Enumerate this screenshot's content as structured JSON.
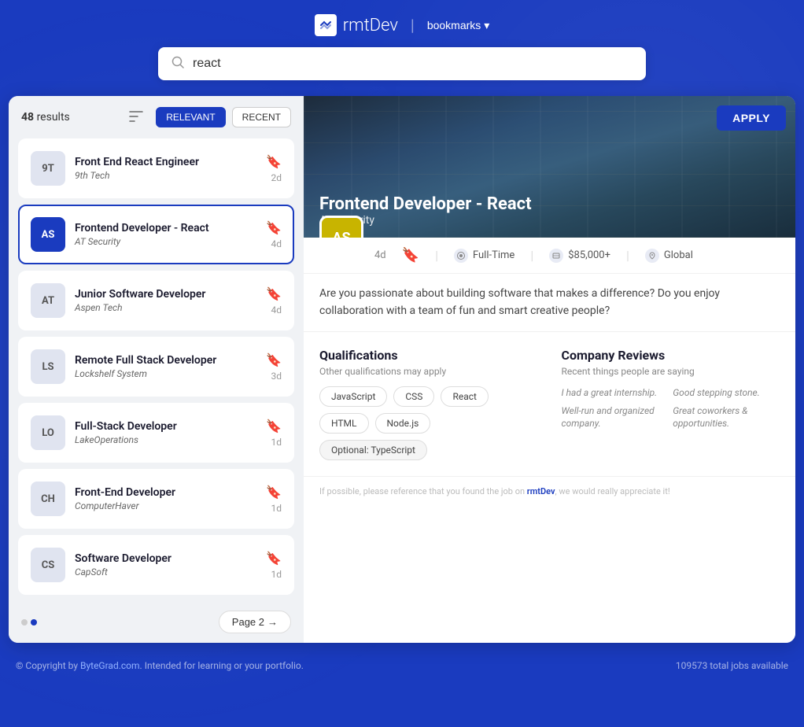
{
  "header": {
    "logo_text_rmt": "rmt",
    "logo_text_dev": "Dev",
    "bookmarks_label": "bookmarks",
    "search_value": "react"
  },
  "results": {
    "count": "48",
    "count_label": "results",
    "sort_relevant": "RELEVANT",
    "sort_recent": "RECENT"
  },
  "jobs": [
    {
      "id": "9t",
      "initials": "9T",
      "title": "Front End React Engineer",
      "company": "9th Tech",
      "age": "2d",
      "selected": false
    },
    {
      "id": "as",
      "initials": "AS",
      "title": "Frontend Developer - React",
      "company": "AT Security",
      "age": "4d",
      "selected": true
    },
    {
      "id": "at",
      "initials": "AT",
      "title": "Junior Software Developer",
      "company": "Aspen Tech",
      "age": "4d",
      "selected": false
    },
    {
      "id": "ls",
      "initials": "LS",
      "title": "Remote Full Stack Developer",
      "company": "Lockshelf System",
      "age": "3d",
      "selected": false
    },
    {
      "id": "lo",
      "initials": "LO",
      "title": "Full-Stack Developer",
      "company": "LakeOperations",
      "age": "1d",
      "selected": false
    },
    {
      "id": "ch",
      "initials": "CH",
      "title": "Front-End Developer",
      "company": "ComputerHaver",
      "age": "1d",
      "selected": false
    },
    {
      "id": "cs",
      "initials": "CS",
      "title": "Software Developer",
      "company": "CapSoft",
      "age": "1d",
      "selected": false
    }
  ],
  "pagination": {
    "current_page": "Page 2",
    "next_arrow": "→"
  },
  "detail": {
    "company_initials": "AS",
    "job_title": "Frontend Developer - React",
    "company_name": "AT Security",
    "description": "Are you passionate about building software that makes a difference? Do you enjoy collaboration with a team of fun and smart creative people?",
    "age": "4d",
    "employment_type": "Full-Time",
    "salary": "$85,000+",
    "location": "Global",
    "apply_label": "APPLY",
    "qualifications": {
      "title": "Qualifications",
      "subtitle": "Other qualifications may apply",
      "tags": [
        "JavaScript",
        "CSS",
        "React",
        "HTML",
        "Node.js"
      ],
      "optional_tag": "Optional: TypeScript"
    },
    "reviews": {
      "title": "Company Reviews",
      "subtitle": "Recent things people are saying",
      "items": [
        "I had a great internship.",
        "Good stepping stone.",
        "Well-run and organized company.",
        "Great coworkers & opportunities."
      ]
    },
    "footer_text": "If possible, please reference that you found the job on ",
    "footer_brand": "rmtDev",
    "footer_text2": ", we would really appreciate it!"
  },
  "site_footer": {
    "copyright": "© Copyright by ",
    "copyright_link": "ByteGrad.com",
    "copyright_sub": ". Intended for learning or your portfolio.",
    "jobs_count": "109573 total jobs available"
  }
}
